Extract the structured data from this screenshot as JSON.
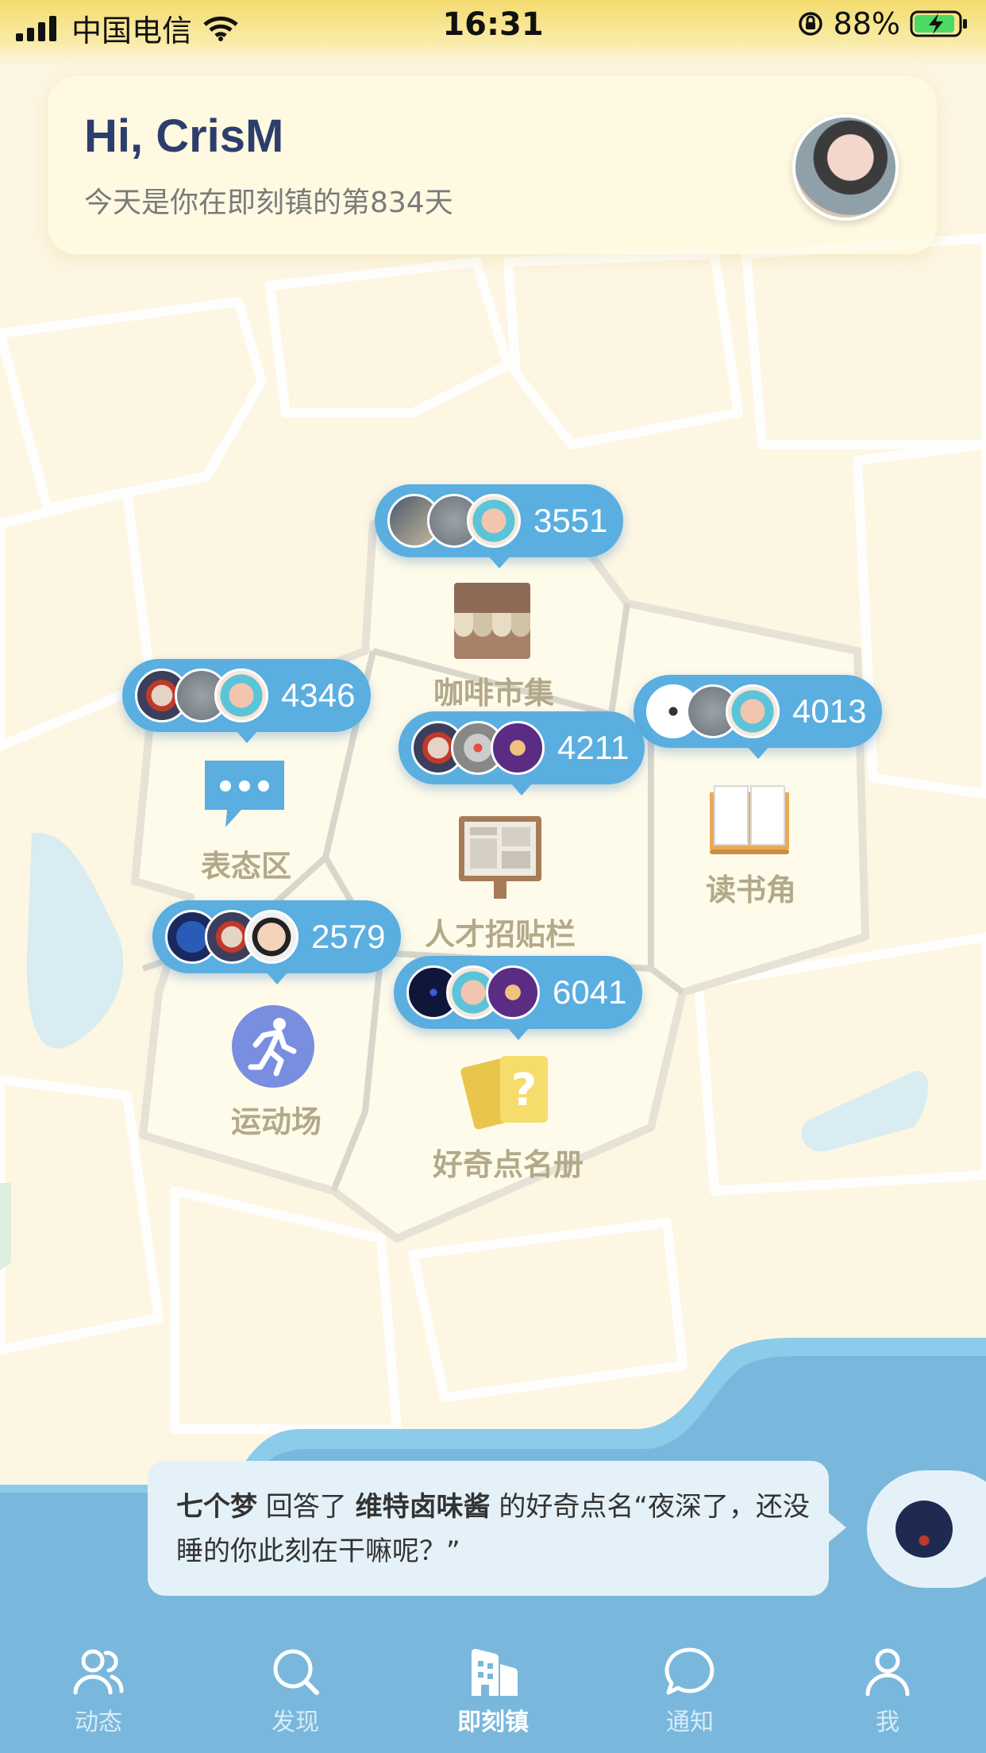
{
  "status_bar": {
    "carrier": "中国电信",
    "time": "16:31",
    "battery": "88%"
  },
  "header": {
    "greeting": "Hi, CrisM",
    "days_text": "今天是你在即刻镇的第834天"
  },
  "buildings": [
    {
      "name": "咖啡市集",
      "count": "3551"
    },
    {
      "name": "表态区",
      "count": "4346"
    },
    {
      "name": "读书角",
      "count": "4013"
    },
    {
      "name": "人才招贴栏",
      "count": "4211"
    },
    {
      "name": "运动场",
      "count": "2579"
    },
    {
      "name": "好奇点名册",
      "count": "6041"
    }
  ],
  "notification": {
    "user": "七个梦",
    "action": " 回答了 ",
    "target": "维特卤味酱",
    "text": " 的好奇点名“夜深了，还没睡的你此刻在干嘛呢？”"
  },
  "tabs": [
    {
      "label": "动态",
      "icon": "people-icon"
    },
    {
      "label": "发现",
      "icon": "search-icon"
    },
    {
      "label": "即刻镇",
      "icon": "town-icon",
      "active": true
    },
    {
      "label": "通知",
      "icon": "chat-bubble-icon"
    },
    {
      "label": "我",
      "icon": "person-icon"
    }
  ],
  "colors": {
    "bubble": "#5aaee0",
    "water": "#79bde0",
    "greeting": "#2c3e6b"
  }
}
